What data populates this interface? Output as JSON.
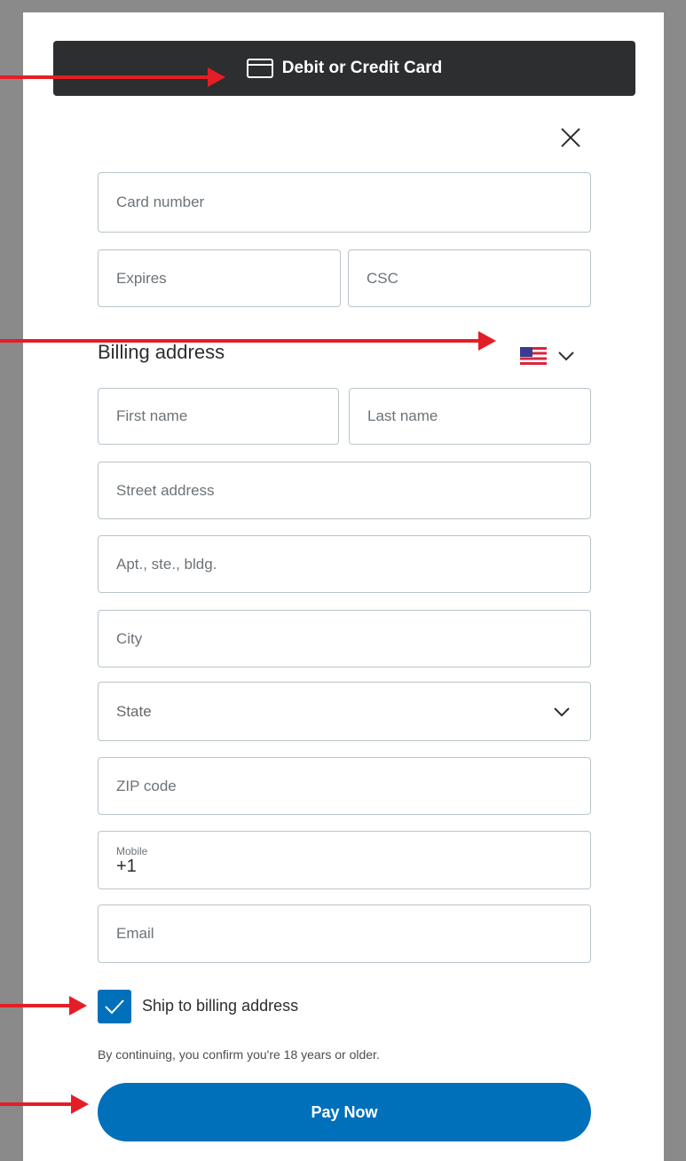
{
  "header": {
    "title": "Debit or Credit Card",
    "icon": "credit-card-icon"
  },
  "form": {
    "card_number": "Card number",
    "expires": "Expires",
    "csc": "CSC",
    "billing_label": "Billing address",
    "country": {
      "icon": "us-flag-icon",
      "selected": "US"
    },
    "first_name": "First name",
    "last_name": "Last name",
    "street": "Street address",
    "apt": "Apt., ste., bldg.",
    "city": "City",
    "state": "State",
    "zip": "ZIP code",
    "mobile_label": "Mobile",
    "mobile_value": "+1",
    "email": "Email"
  },
  "ship_to_billing": {
    "label": "Ship to billing address",
    "checked": true
  },
  "disclaimer": "By continuing, you confirm you're 18 years or older.",
  "pay_button": "Pay Now",
  "colors": {
    "header_bg": "#2c2e2f",
    "primary": "#0070ba",
    "border": "#b9c4c9",
    "arrow": "#e41e26"
  }
}
